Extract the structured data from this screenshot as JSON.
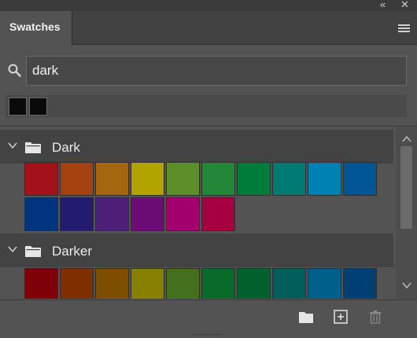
{
  "panel": {
    "tab_label": "Swatches",
    "collapse_glyph": "«",
    "close_glyph": "✕",
    "menu_icon": "hamburger-menu-icon"
  },
  "search": {
    "value": "dark",
    "icon": "search-icon"
  },
  "recent_colors": [
    "#0a0a0a",
    "#0a0a0a"
  ],
  "groups": [
    {
      "name": "Dark",
      "expanded": true,
      "swatches": [
        [
          "#a3111a",
          "#a5420f",
          "#a5660f",
          "#b2a400",
          "#5c8e2a",
          "#228737",
          "#007c3a",
          "#007a72",
          "#0081b3",
          "#005594"
        ],
        [
          "#00347f",
          "#231b6f",
          "#4e1f76",
          "#6b0d75",
          "#a3006d",
          "#a70041"
        ]
      ]
    },
    {
      "name": "Darker",
      "expanded": true,
      "swatches": [
        [
          "#7e0008",
          "#7f2e00",
          "#7f4d00",
          "#868000",
          "#43701d",
          "#0a6a2a",
          "#00612c",
          "#005f5b",
          "#00608a",
          "#003f73"
        ]
      ]
    }
  ],
  "footer": {
    "buttons": [
      "new-group-folder-icon",
      "new-swatch-plus-icon",
      "delete-trash-icon"
    ]
  },
  "colors": {
    "panel_bg": "#535353",
    "header_bg": "#424242",
    "group_header_bg": "#434343",
    "text": "#e6e6e6"
  }
}
